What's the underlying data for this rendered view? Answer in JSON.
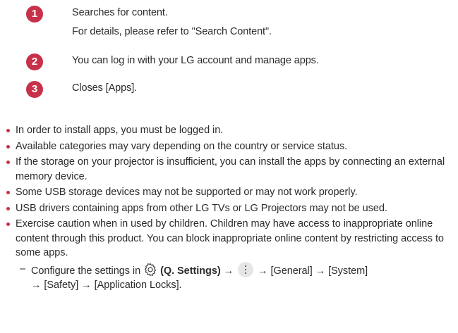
{
  "numbered_items": [
    {
      "number": "1",
      "lines": [
        "Searches for content.",
        "For details, please refer to \"Search Content\"."
      ]
    },
    {
      "number": "2",
      "lines": [
        "You can log in with your LG account and manage apps."
      ]
    },
    {
      "number": "3",
      "lines": [
        "Closes [Apps]."
      ]
    }
  ],
  "notes": [
    "In order to install apps, you must be logged in.",
    "Available categories may vary depending on the country or service status.",
    "If the storage on your projector is insufficient, you can install the apps by connecting an external memory device.",
    "Some USB storage devices may not be supported or may not work properly.",
    "USB drivers containing apps from other LG TVs or LG Projectors may not be used.",
    "Exercise caution when in used by children. Children may have access to inappropriate online content through this product. You can block inappropriate online content by restricting access to some apps."
  ],
  "sub_note": {
    "dash": "–",
    "prefix": "Configure the settings in",
    "settings_label": "(Q. Settings)",
    "arrow": "→",
    "path_rest": "[General] → [System]",
    "path_line2": "→ [Safety] → [Application Locks]."
  },
  "colors": {
    "accent": "#c8314a",
    "text": "#2b2b2b",
    "button_bg": "#e6e6e6"
  },
  "icons": {
    "settings": "gear-icon",
    "more": "more-options-icon"
  }
}
